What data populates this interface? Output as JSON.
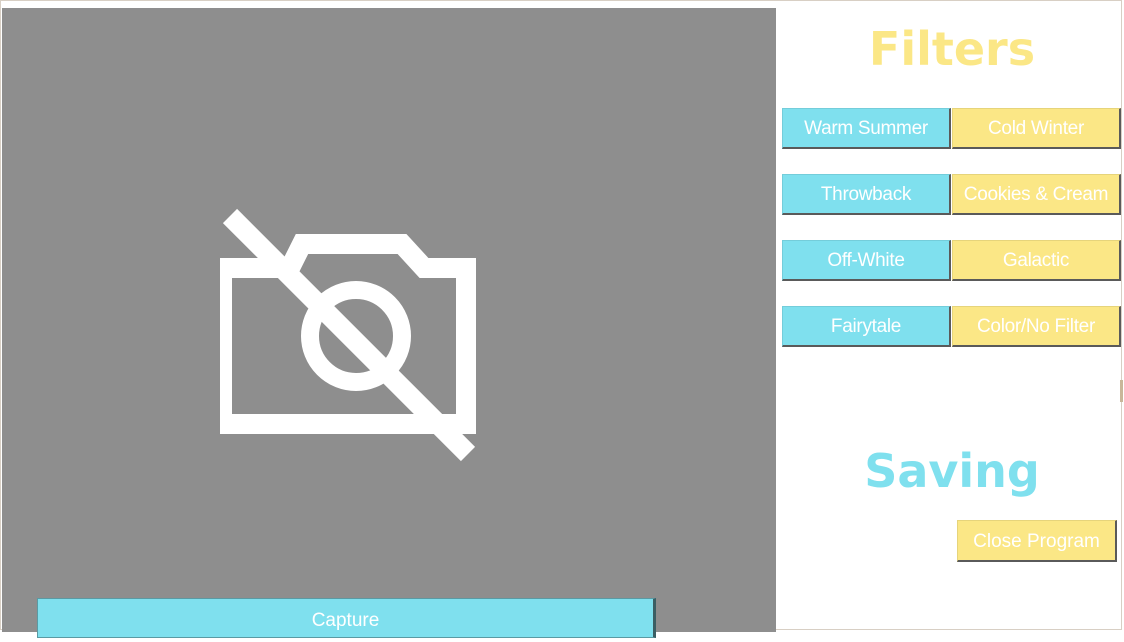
{
  "preview": {
    "icon": "camera-off-icon",
    "capture_label": "Capture"
  },
  "filters": {
    "title": "Filters",
    "buttons": [
      {
        "label": "Warm Summer",
        "color": "#7fe0ee"
      },
      {
        "label": "Cold Winter",
        "color": "#fbe786"
      },
      {
        "label": "Throwback",
        "color": "#7fe0ee"
      },
      {
        "label": "Cookies & Cream",
        "color": "#fbe786"
      },
      {
        "label": "Off-White",
        "color": "#7fe0ee"
      },
      {
        "label": "Galactic",
        "color": "#fbe786"
      },
      {
        "label": "Fairytale",
        "color": "#7fe0ee"
      },
      {
        "label": "Color/No Filter",
        "color": "#fbe786"
      }
    ]
  },
  "saving": {
    "title": "Saving",
    "close_label": "Close Program"
  },
  "colors": {
    "accent_blue": "#7fe0ee",
    "accent_yellow": "#fbe786",
    "preview_bg": "#8e8e8e"
  }
}
